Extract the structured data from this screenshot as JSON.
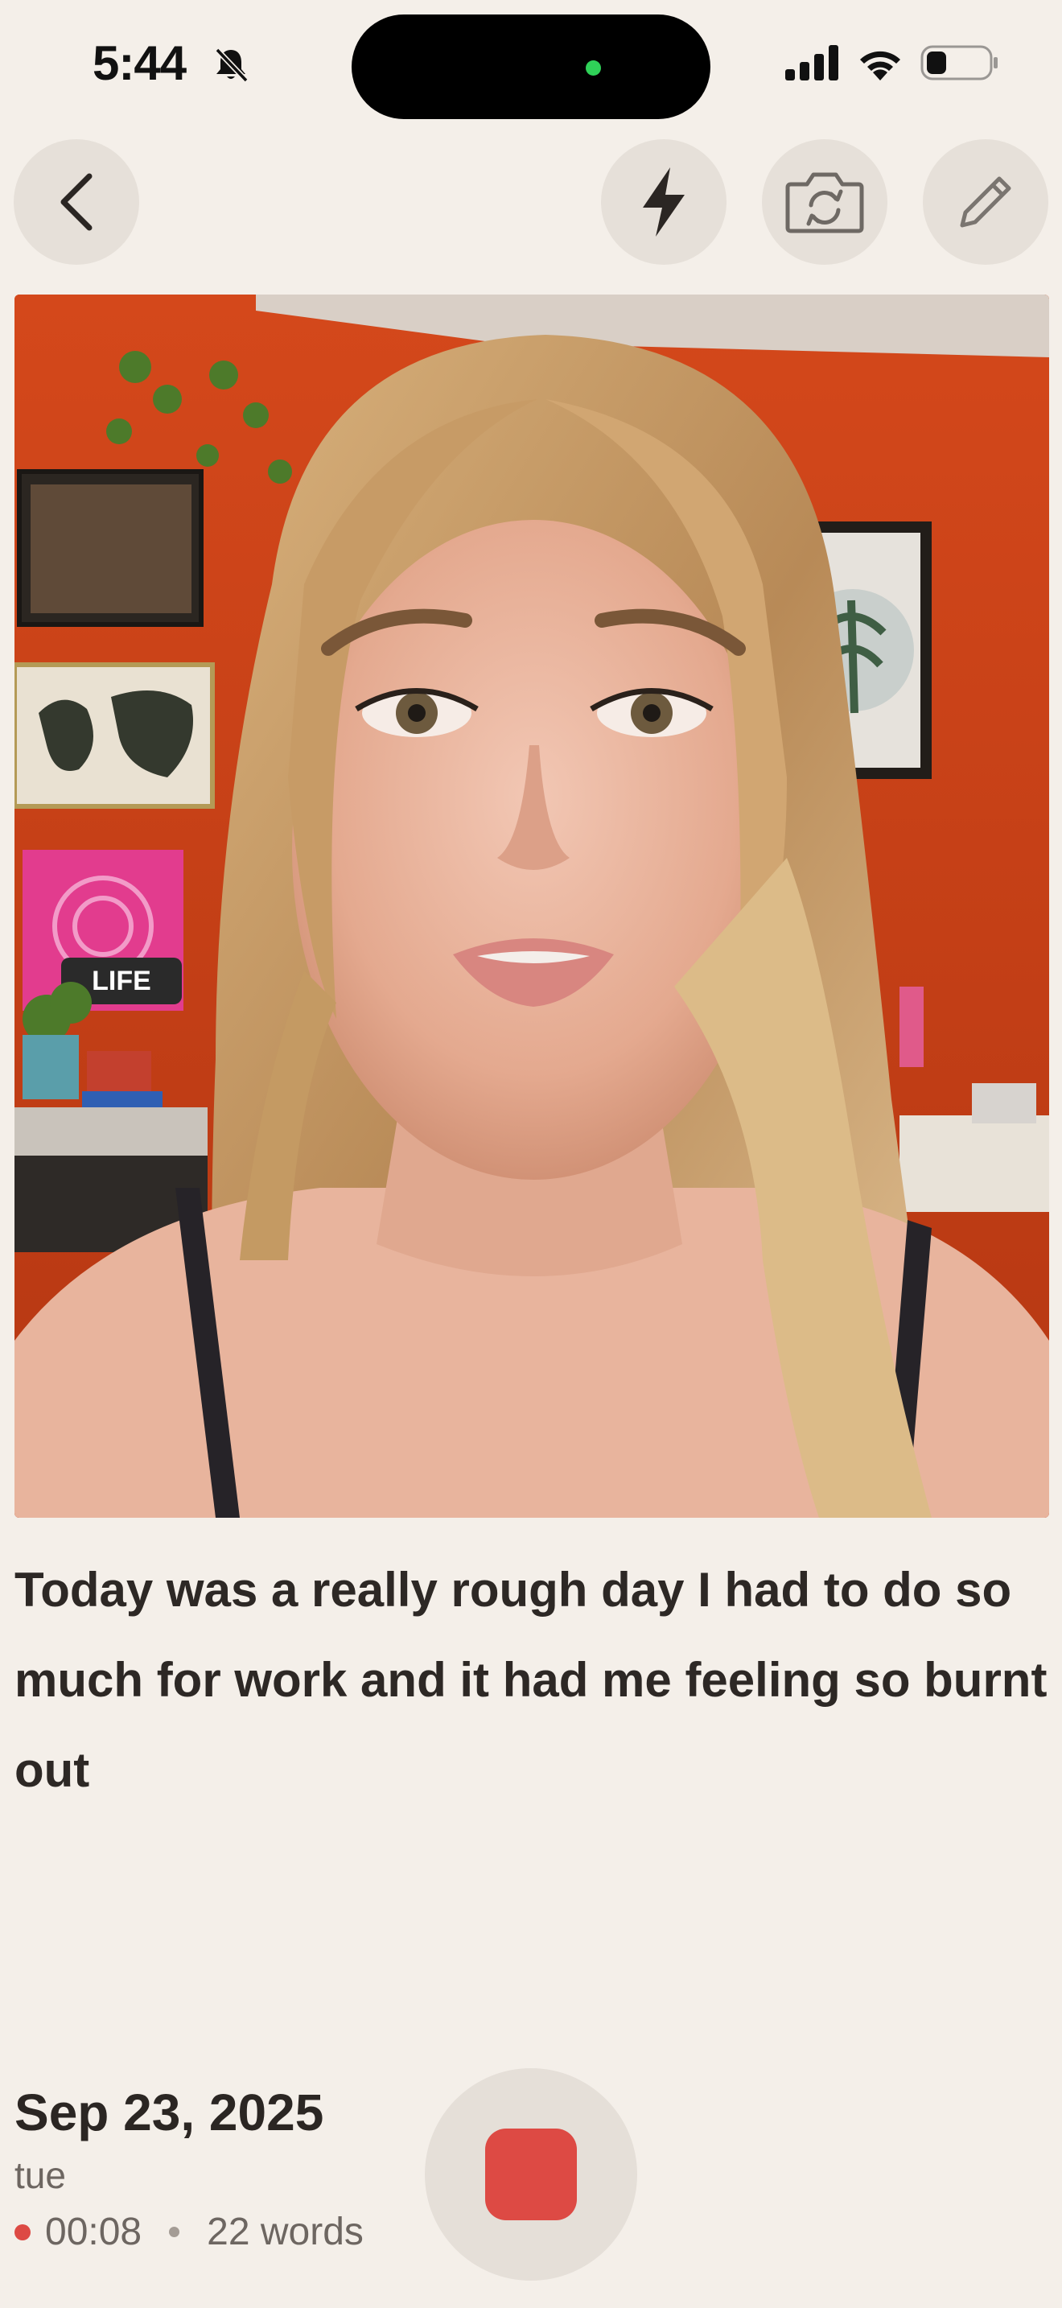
{
  "status_bar": {
    "time": "5:44",
    "icons": [
      "bell-slash-icon",
      "cellular-signal-icon",
      "wifi-icon",
      "battery-icon"
    ]
  },
  "toolbar": {
    "buttons": [
      "back-chevron-icon",
      "flash-bolt-icon",
      "camera-flip-icon",
      "pencil-edit-icon"
    ]
  },
  "photo": {
    "description_icon": "video-frame",
    "sign_text": "LIFE"
  },
  "transcript": {
    "text": "Today was a really rough day I had to do so much for work and it had me feeling so burnt out"
  },
  "entry": {
    "date": "Sep 23, 2025",
    "weekday": "tue",
    "duration": "00:08",
    "word_count": "22 words"
  },
  "colors": {
    "background": "#f4efe9",
    "button_bg": "#e6e0d9",
    "record_red": "#dd4a44",
    "wall_orange": "#c63e18"
  }
}
